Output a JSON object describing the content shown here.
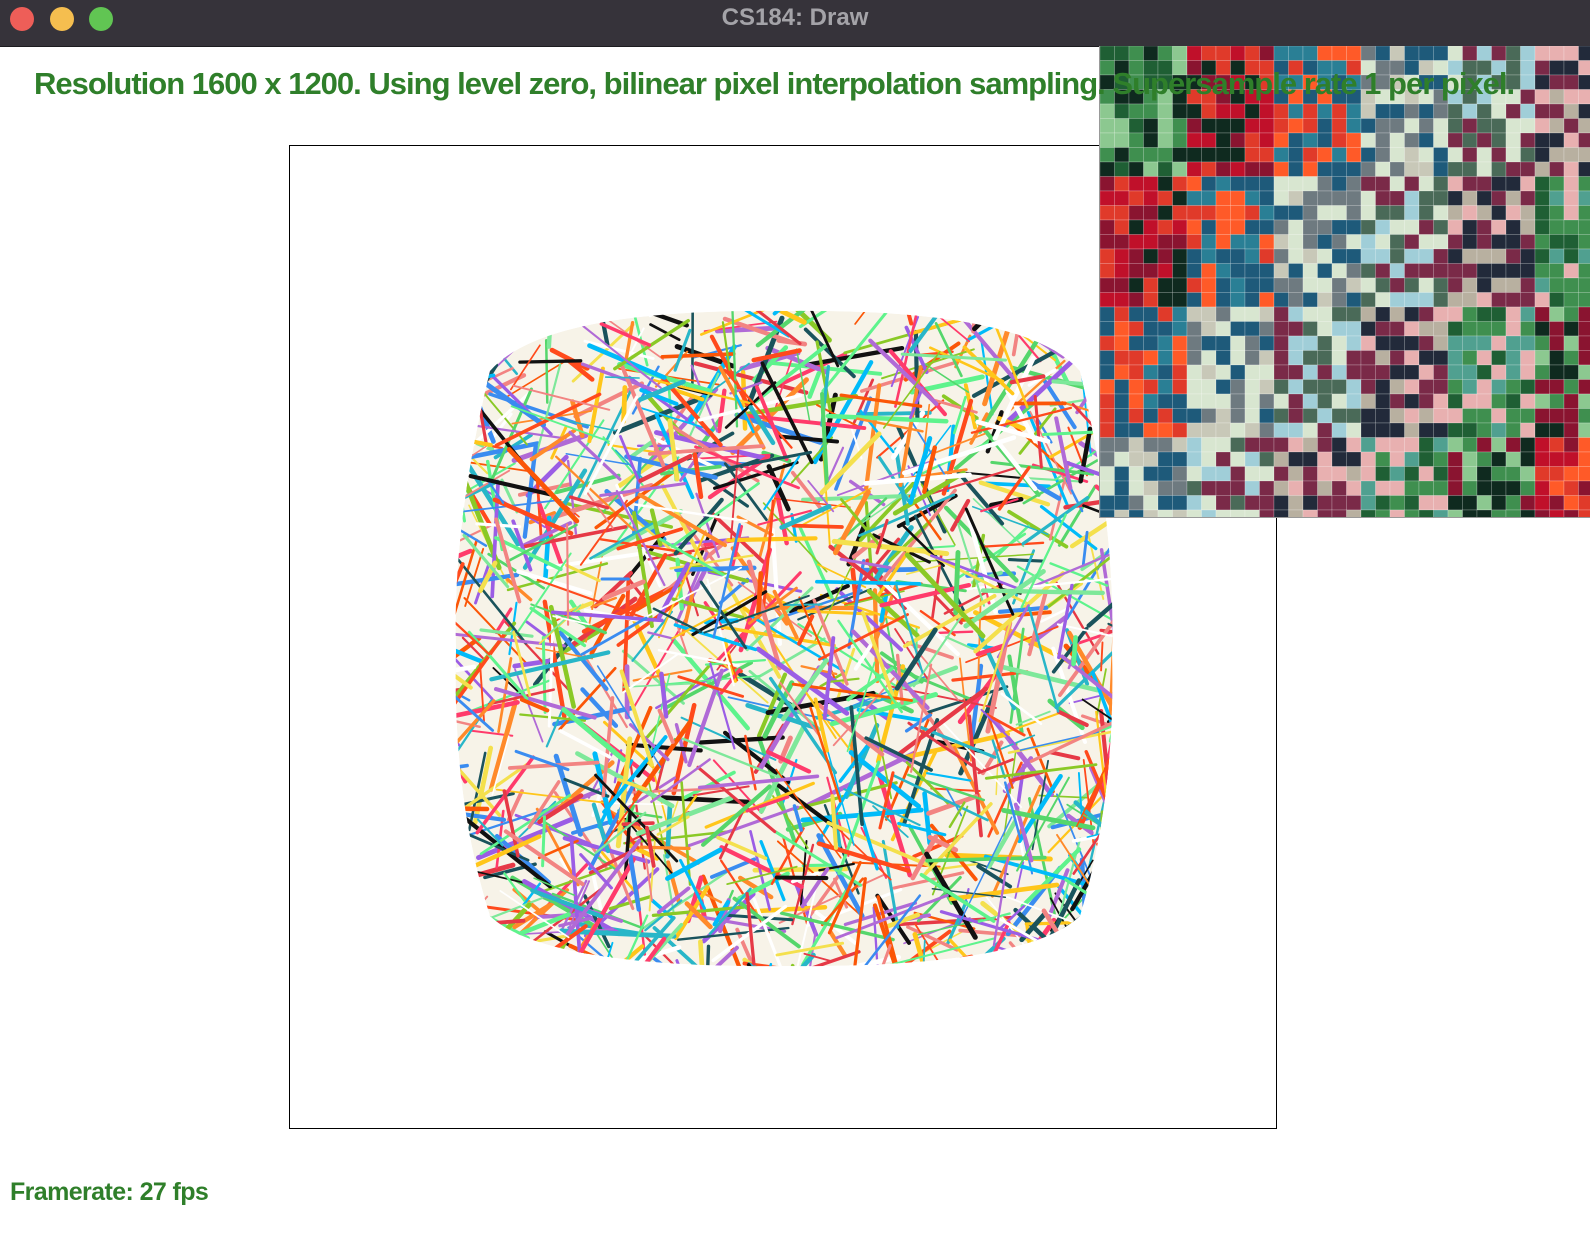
{
  "window": {
    "title": "CS184: Draw",
    "buttons": [
      "close",
      "minimize",
      "maximize"
    ]
  },
  "status": {
    "message": "Resolution 1600 x 1200. Using level zero, bilinear pixel interpolation sampling. Supersample rate 1 per pixel.",
    "framerate": "Framerate: 27 fps"
  },
  "colors": {
    "status_text": "#2f7f2a",
    "titlebar": "#36333a",
    "close": "#ee5e58",
    "minimize": "#f5be4f",
    "maximize": "#61c553"
  },
  "canvas": {
    "content": "texture-mapped warped square made of colorful random strokes",
    "palette": [
      "#ff4a1c",
      "#ffc61a",
      "#7ee89a",
      "#28b6c8",
      "#111111",
      "#ff3b6b",
      "#3a8cf0",
      "#b06ad6",
      "#ff8a2a",
      "#55d66b",
      "#f4e04d",
      "#e63946",
      "#9b5de5",
      "#00bbf9",
      "#fb5607",
      "#8ac926",
      "#ffffff",
      "#1a535c",
      "#f28482",
      "#5ef38c"
    ]
  },
  "zoom_inset": {
    "content": "magnified pixel grid of the texture under the cursor",
    "palette": [
      "#1f5f34",
      "#3f8f4f",
      "#8cc890",
      "#0f2a1f",
      "#8a1430",
      "#c0102a",
      "#e03a2a",
      "#ff5a28",
      "#2a7f95",
      "#1e5a7a",
      "#6e7a80",
      "#c8c8b8",
      "#d8e6d0",
      "#a0ced8",
      "#4a6a58",
      "#7a2a48",
      "#222a3a",
      "#b8b0a0",
      "#e8b0b0",
      "#50a090"
    ]
  }
}
